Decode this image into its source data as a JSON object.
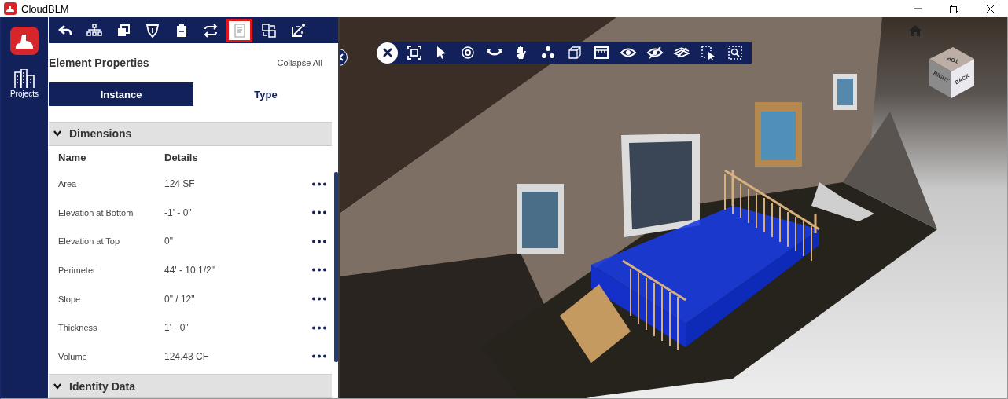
{
  "window": {
    "title": "CloudBLM"
  },
  "sidebar": {
    "items": [
      {
        "label": "Projects",
        "selected": false
      }
    ]
  },
  "panel_toolbar": [
    {
      "kind": "undo",
      "selected": false
    },
    {
      "kind": "hierarchy",
      "selected": false
    },
    {
      "kind": "layers",
      "selected": false
    },
    {
      "kind": "shield",
      "selected": false
    },
    {
      "kind": "clipboard",
      "selected": false
    },
    {
      "kind": "sync",
      "selected": false
    },
    {
      "kind": "document",
      "selected": true
    },
    {
      "kind": "compare",
      "selected": false
    },
    {
      "kind": "markup",
      "selected": false
    }
  ],
  "panel": {
    "title": "Element Properties",
    "collapse_all": "Collapse All",
    "tabs": [
      {
        "label": "Instance",
        "selected": true
      },
      {
        "label": "Type",
        "selected": false
      }
    ],
    "sections": [
      {
        "title": "Dimensions",
        "expanded": true,
        "columns": [
          "Name",
          "Details"
        ],
        "rows": [
          {
            "name": "Area",
            "details": "124 SF"
          },
          {
            "name": "Elevation at Bottom",
            "details": "-1' - 0\""
          },
          {
            "name": "Elevation at Top",
            "details": "0\""
          },
          {
            "name": "Perimeter",
            "details": "44' - 10 1/2\""
          },
          {
            "name": "Slope",
            "details": "0\" / 12\""
          },
          {
            "name": "Thickness",
            "details": "1' - 0\""
          },
          {
            "name": "Volume",
            "details": "124.43 CF"
          }
        ]
      },
      {
        "title": "Identity Data",
        "expanded": true
      }
    ]
  },
  "viewer_toolbar": [
    {
      "kind": "close"
    },
    {
      "kind": "fit"
    },
    {
      "kind": "select"
    },
    {
      "kind": "orbit"
    },
    {
      "kind": "rotate"
    },
    {
      "kind": "pan"
    },
    {
      "kind": "explode"
    },
    {
      "kind": "box"
    },
    {
      "kind": "section"
    },
    {
      "kind": "show"
    },
    {
      "kind": "hide"
    },
    {
      "kind": "isolate"
    },
    {
      "kind": "select-box"
    },
    {
      "kind": "zoom-box"
    }
  ],
  "nav_cube": {
    "faces": [
      "TOP",
      "RIGHT",
      "BACK"
    ]
  }
}
